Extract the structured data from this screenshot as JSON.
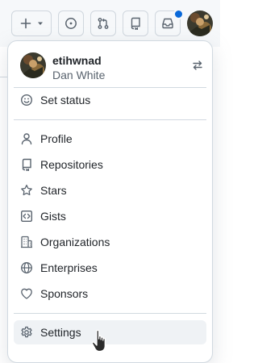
{
  "topbar": {
    "create_icon": "plus-icon",
    "create_caret_icon": "triangle-down-icon",
    "issues_icon": "issue-opened-icon",
    "pulls_icon": "git-pull-request-icon",
    "repos_icon": "repo-icon",
    "inbox_icon": "inbox-icon",
    "has_unread_notifications": true,
    "notification_dot_color": "#0969da"
  },
  "user_menu": {
    "username": "etihwnad",
    "full_name": "Dan White",
    "switch_account_icon": "arrow-switch-icon",
    "groups": [
      [
        {
          "key": "set-status",
          "label": "Set status",
          "icon": "smiley-icon"
        }
      ],
      [
        {
          "key": "profile",
          "label": "Profile",
          "icon": "person-icon"
        },
        {
          "key": "repositories",
          "label": "Repositories",
          "icon": "repo-icon"
        },
        {
          "key": "stars",
          "label": "Stars",
          "icon": "star-icon"
        },
        {
          "key": "gists",
          "label": "Gists",
          "icon": "code-square-icon"
        },
        {
          "key": "organizations",
          "label": "Organizations",
          "icon": "organization-icon"
        },
        {
          "key": "enterprises",
          "label": "Enterprises",
          "icon": "globe-icon"
        },
        {
          "key": "sponsors",
          "label": "Sponsors",
          "icon": "heart-icon"
        }
      ],
      [
        {
          "key": "settings",
          "label": "Settings",
          "icon": "gear-icon",
          "hovered": true
        }
      ]
    ]
  }
}
